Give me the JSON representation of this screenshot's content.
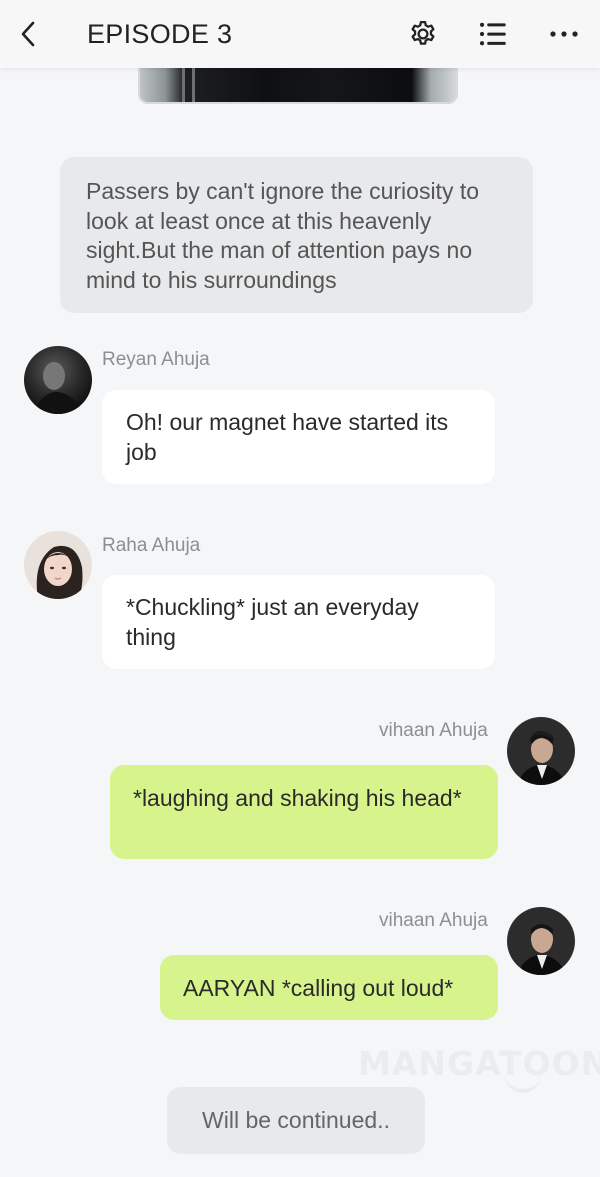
{
  "header": {
    "title": "EPISODE 3",
    "back_icon": "chevron-left-icon",
    "settings_icon": "gear-icon",
    "list_icon": "list-icon",
    "more_icon": "more-horizontal-icon"
  },
  "narration": {
    "text": "Passers by can't ignore the curiosity to look at least once at this heavenly sight.But the man of attention pays no mind to his surroundings"
  },
  "messages": [
    {
      "side": "left",
      "name": "Reyan Ahuja",
      "text": "Oh! our magnet have started its job"
    },
    {
      "side": "left",
      "name": "Raha Ahuja",
      "text": "*Chuckling* just an everyday thing"
    },
    {
      "side": "right",
      "name": "vihaan Ahuja",
      "text": "*laughing and shaking his head*"
    },
    {
      "side": "right",
      "name": "vihaan Ahuja",
      "text": "AARYAN *calling out loud*"
    }
  ],
  "footer": {
    "continued": "Will be continued..",
    "watermark": "MANGATOON"
  },
  "colors": {
    "background": "#f5f6f8",
    "left_bubble": "#ffffff",
    "right_bubble": "#d7f48c",
    "narration": "#e8e9eb"
  }
}
